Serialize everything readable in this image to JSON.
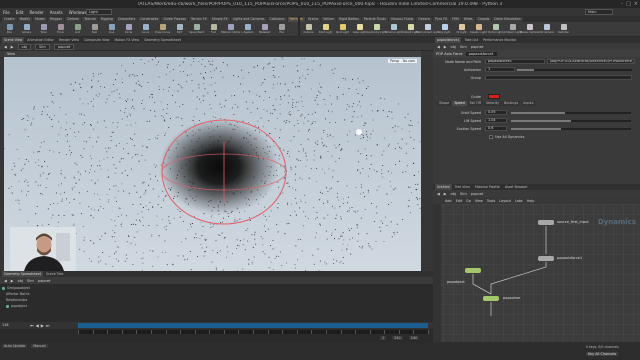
{
  "window": {
    "title": "/ATLAS/Work/edu-cb/work_files/POP/POPS_010_115_POPAxisForce/POPS_010_115_POPAxisForce_000.hiplc - Houdini Indie Limited-Commercial 19.0.498 - Python 3"
  },
  "menu": [
    "File",
    "Edit",
    "Render",
    "Assets",
    "Windows",
    "Help"
  ],
  "desktop": "Light",
  "search_label": "Main",
  "shelf_tabs": [
    "Create",
    "Modify",
    "Model",
    "Polygon",
    "Deform",
    "Texture",
    "Rigging",
    "Characters",
    "Constraints",
    "Guide Process",
    "Terrain FX",
    "Simple FX",
    "Lights and Cameras",
    "Collisions",
    "Particles",
    "Grains",
    "Vellum",
    "Rigid Bodies",
    "Particle Fluids",
    "Viscous Fluids",
    "Oceans",
    "Pyro FX",
    "FEM",
    "Wires",
    "Crowds",
    "Drive Simulation"
  ],
  "shelf_tools_left": [
    "Box",
    "Sphere",
    "Tube",
    "Torus",
    "Grid",
    "Null",
    "Line",
    "Circle",
    "Curve",
    "Draw Curve",
    "Path",
    "Spray Paint",
    "Font",
    "Platonic Solids",
    "L-System",
    "Metaball",
    "File"
  ],
  "shelf_tools_right": [
    "Camera",
    "Point Light",
    "Spot Light",
    "Area Light",
    "Geometry Light",
    "Volume Light",
    "Distant Light",
    "Environment Light",
    "Sky Light",
    "GI Light",
    "Caustic Light",
    "Portal Light",
    "Ambient Light",
    "Stereo Camera",
    "VR Camera",
    "Switcher"
  ],
  "viewport": {
    "tabs": [
      "Scene View",
      "Animation Editor",
      "Render View",
      "Composite View",
      "Motion FX View",
      "Geometry Spreadsheet"
    ],
    "path": [
      "obj",
      "Sim",
      "popnet"
    ],
    "header": "View",
    "persp": "Persp",
    "camera": "No cam",
    "fps": "26fps",
    "help_left": "ect. Middle pans. Right dollies. Ctrl+Alt+Left box-zooms. Ctrl+Right zooms. Spacebar Ctrl-Left tilts. Hold L for alternate tumble, dolly, and zoom.",
    "help_right": "M or Alt+M for First Person Navigation."
  },
  "scene_tree": {
    "tabs": [
      "Geometry Spreadsheet",
      "Scene Tree"
    ],
    "path": [
      "obj",
      "Sim",
      "popnet"
    ],
    "items": [
      "Sim/popobject",
      "Affector Matrix",
      "Relationships",
      "popobject"
    ]
  },
  "timeline": {
    "frame": "116",
    "start": "1",
    "end": "240",
    "range_end": "240",
    "realtime": "Auto Update"
  },
  "params": {
    "tabs": [
      "Take List",
      "Performance Monitor"
    ],
    "path": [
      "obj",
      "Sim",
      "popnet"
    ],
    "node_type": "POP Axis Force",
    "node_name": "popaxisforce1",
    "rows": [
      {
        "label": "Node Name and Path",
        "value": "popaxisforce1"
      },
      {
        "label": "Activation",
        "value": "1"
      },
      {
        "label": "Group",
        "value": ""
      },
      {
        "label": "Guide",
        "value": ""
      }
    ],
    "sub_tabs": [
      "Shape",
      "Speed",
      "Fall Off",
      "Velocity",
      "Bindings",
      "Inputs"
    ],
    "active_tab": "Speed",
    "speed_rows": [
      {
        "label": "Orbit Speed",
        "value": "0.05",
        "fill": 0.45
      },
      {
        "label": "Lift Speed",
        "value": "1.04",
        "fill": 0.5
      },
      {
        "label": "Suction Speed",
        "value": "0.6",
        "fill": 0.42
      }
    ],
    "checkbox_label": "Use All Dynamics",
    "guide_color": "#d8231c",
    "path_value": "/obj/POP.014.AxisForce/AxisForce1/POPAxisForce_Guide"
  },
  "network": {
    "tabs": [
      "Untitled",
      "Tree View",
      "Material Palette",
      "Asset Browser"
    ],
    "path": [
      "obj",
      "Sim",
      "popnet"
    ],
    "menu": [
      "Add",
      "Edit",
      "Go",
      "View",
      "Tools",
      "Layout",
      "Labs",
      "Help"
    ],
    "context": "Dynamics",
    "nodes": [
      {
        "name": "source_first_input",
        "color": "#a8a8a8"
      },
      {
        "name": "popaxisforce1",
        "color": "#a8a8a8"
      },
      {
        "name": "popsolver",
        "color": "#a6c66a"
      },
      {
        "name": "popobject",
        "color": "#a6c66a"
      }
    ]
  },
  "status": {
    "keys": [
      "Auto Update",
      "Manual"
    ],
    "channels": "0 keys, 0/0 channels",
    "keyall": "Key All Channels"
  }
}
